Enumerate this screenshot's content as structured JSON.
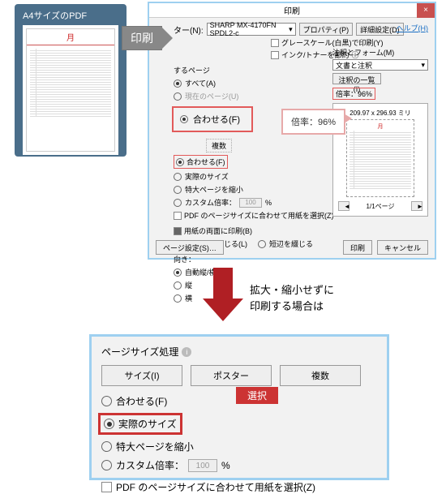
{
  "pdf_thumb": {
    "label": "A4サイズのPDF",
    "month": "月"
  },
  "print_badge": "印刷",
  "dialog": {
    "title": "印刷",
    "printer_label": "ター(N):",
    "printer_value": "SHARP MX-4170FN SPDL2-c",
    "props_btn": "プロパティ(P)",
    "advanced_btn": "詳細設定(D)",
    "help": "ヘルプ(H)",
    "grayscale": "グレースケール(白黒)で印刷(Y)",
    "save_ink": "インク/トナーを節約",
    "info_icon": "ⓘ",
    "pages_section": "するページ",
    "all": "すべて(A)",
    "current": "現在のページ(U)",
    "fit": "合わせる(F)",
    "count_btn": "複数",
    "fit_small": "合わせる(F)",
    "actual": "実際のサイズ",
    "shrink_large": "特大ページを縮小",
    "custom_scale": "カスタム倍率：",
    "custom_scale_val": "100",
    "pct": "%",
    "paper_by_pdf": "PDF のページサイズに合わせて用紙を選択(Z)",
    "both_sides": "用紙の両面に印刷(B)",
    "bind_long": "長辺を綴じる(L)",
    "bind_short": "短辺を綴じる",
    "orientation": "向き：",
    "auto_orient": "自動縦/横(R)",
    "portrait": "縦",
    "landscape": "横",
    "page_setup": "ページ設定(S)…",
    "print_btn": "印刷",
    "cancel_btn": "キャンセル"
  },
  "rside": {
    "label": "注釈とフォーム(M)",
    "value": "文書と注釈",
    "summary_btn": "注釈の一覧(I)",
    "ratio": "倍率：96%",
    "dims": "209.97 x 296.93 ミリ",
    "month": "月",
    "page_of": "1/1ページ"
  },
  "callout": "倍率：96%",
  "arrow_text": {
    "l1": "拡大・縮小せずに",
    "l2": "印刷する場合は"
  },
  "lower": {
    "title": "ページサイズ処理",
    "tab_size": "サイズ(I)",
    "tab_poster": "ポスター",
    "tab_multi": "複数",
    "select_badge": "選択",
    "fit": "合わせる(F)",
    "actual": "実際のサイズ",
    "shrink": "特大ページを縮小",
    "custom": "カスタム倍率：",
    "custom_val": "100",
    "pct": "%",
    "paper_by_pdf": "PDF のページサイズに合わせて用紙を選択(Z)"
  }
}
